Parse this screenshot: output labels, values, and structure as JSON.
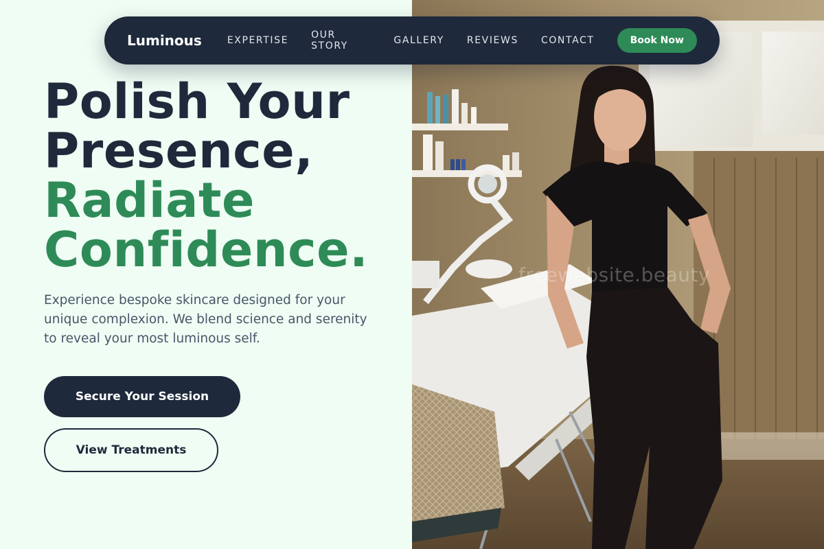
{
  "brand": {
    "name": "Luminous"
  },
  "nav": {
    "links": [
      "EXPERTISE",
      "OUR STORY",
      "GALLERY",
      "REVIEWS",
      "CONTACT"
    ],
    "cta_label": "Book Now"
  },
  "hero": {
    "title_lines": [
      "Polish Your",
      "Presence,"
    ],
    "accent_lines": [
      "Radiate",
      "Confidence."
    ],
    "subtitle": "Experience bespoke skincare designed for your unique complexion. We blend science and serenity to reveal your most luminous self.",
    "primary_cta": "Secure Your Session",
    "secondary_cta": "View Treatments"
  },
  "photo": {
    "watermark": "freewebsite.beauty"
  },
  "colors": {
    "background": "#effdf4",
    "navy": "#1e293b",
    "accent_green": "#2e8b57",
    "body_text": "#475569"
  }
}
